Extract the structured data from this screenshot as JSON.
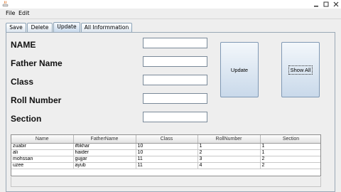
{
  "window": {
    "icon": "java-app-icon",
    "controls": [
      "minimize-icon",
      "maximize-icon",
      "close-icon"
    ]
  },
  "menu": {
    "file": "File",
    "edit": "Edit"
  },
  "tabs": [
    {
      "label": "Save"
    },
    {
      "label": "Delete"
    },
    {
      "label": "Update"
    },
    {
      "label": "All Informmation"
    }
  ],
  "selected_tab": "Update",
  "form": {
    "name_label": "NAME",
    "father_label": "Father Name",
    "class_label": "Class",
    "roll_label": "Roll Number",
    "section_label": "Section",
    "name_value": "",
    "father_value": "",
    "class_value": "",
    "roll_value": "",
    "section_value": ""
  },
  "buttons": {
    "update": "Update",
    "show_all": "Show All"
  },
  "table": {
    "headers": [
      "Name",
      "FatherName",
      "Class",
      "RollNumber",
      "Section"
    ],
    "rows": [
      [
        "zuabir",
        "iftikhar",
        "10",
        "1",
        "1"
      ],
      [
        "ali",
        "haider",
        "10",
        "2",
        "1"
      ],
      [
        "mohssan",
        "gujjar",
        "11",
        "3",
        "2"
      ],
      [
        "uzee",
        "ayub",
        "11",
        "4",
        "2"
      ]
    ]
  },
  "colors": {
    "button_gradient_top": "#f3f7fb",
    "button_gradient_bottom": "#c9d9ea",
    "panel_bg": "#eeeeee",
    "close_red": "#c75050"
  }
}
